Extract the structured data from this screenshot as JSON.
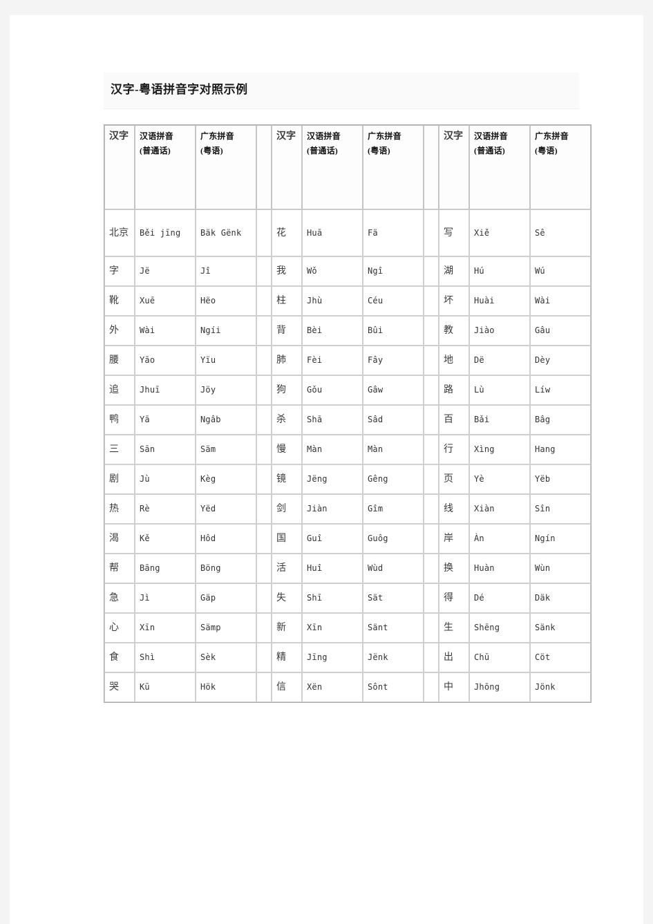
{
  "document": {
    "title": "汉字-粤语拼音字对照示例"
  },
  "table": {
    "headers": {
      "hanzi": "汉字",
      "mandarin": "汉语拼音（普通话）",
      "cantonese": "广东拼音（粤语）",
      "spacer": ""
    },
    "header_parts": {
      "hanzi": "汉字",
      "mandarin_line1": "汉语拼音",
      "mandarin_line2": "(普通话)",
      "cantonese_line1": "广东拼音",
      "cantonese_line2": "(粤语)"
    },
    "rows": [
      {
        "a": {
          "hanzi": "北京",
          "mandarin": "Běi jīng",
          "cantonese": "Bäk Gënk"
        },
        "b": {
          "hanzi": "花",
          "mandarin": "Huā",
          "cantonese": "Fä"
        },
        "c": {
          "hanzi": "写",
          "mandarin": "Xiě",
          "cantonese": "Sê"
        }
      },
      {
        "a": {
          "hanzi": "字",
          "mandarin": "Jë",
          "cantonese": "Jî"
        },
        "b": {
          "hanzi": "我",
          "mandarin": "Wǒ",
          "cantonese": "Ngî"
        },
        "c": {
          "hanzi": "湖",
          "mandarin": "Hú",
          "cantonese": "Wú"
        }
      },
      {
        "a": {
          "hanzi": "靴",
          "mandarin": "Xuē",
          "cantonese": "Hëo"
        },
        "b": {
          "hanzi": "柱",
          "mandarin": "Jhù",
          "cantonese": "Céu"
        },
        "c": {
          "hanzi": "坏",
          "mandarin": "Huài",
          "cantonese": "Wài"
        }
      },
      {
        "a": {
          "hanzi": "外",
          "mandarin": "Wài",
          "cantonese": "Ngíi"
        },
        "b": {
          "hanzi": "背",
          "mandarin": "Bèi",
          "cantonese": "Bûi"
        },
        "c": {
          "hanzi": "教",
          "mandarin": "Jiào",
          "cantonese": "Gâu"
        }
      },
      {
        "a": {
          "hanzi": "腰",
          "mandarin": "Yāo",
          "cantonese": "Yïu"
        },
        "b": {
          "hanzi": "肺",
          "mandarin": "Fèi",
          "cantonese": "Fây"
        },
        "c": {
          "hanzi": "地",
          "mandarin": "Dë",
          "cantonese": "Dèy"
        }
      },
      {
        "a": {
          "hanzi": "追",
          "mandarin": "Jhuī",
          "cantonese": "Jöy"
        },
        "b": {
          "hanzi": "狗",
          "mandarin": "Gǒu",
          "cantonese": "Gâw"
        },
        "c": {
          "hanzi": "路",
          "mandarin": "Lù",
          "cantonese": "Líw"
        }
      },
      {
        "a": {
          "hanzi": "鸭",
          "mandarin": "Yā",
          "cantonese": "Ngâb"
        },
        "b": {
          "hanzi": "杀",
          "mandarin": "Shā",
          "cantonese": "Sâd"
        },
        "c": {
          "hanzi": "百",
          "mandarin": "Bǎi",
          "cantonese": "Bâg"
        }
      },
      {
        "a": {
          "hanzi": "三",
          "mandarin": "Sān",
          "cantonese": "Säm"
        },
        "b": {
          "hanzi": "慢",
          "mandarin": "Màn",
          "cantonese": "Màn"
        },
        "c": {
          "hanzi": "行",
          "mandarin": "Xìng",
          "cantonese": "Hang"
        }
      },
      {
        "a": {
          "hanzi": "剧",
          "mandarin": "Jù",
          "cantonese": "Kèg"
        },
        "b": {
          "hanzi": "镜",
          "mandarin": "Jëng",
          "cantonese": "Gêng"
        },
        "c": {
          "hanzi": "页",
          "mandarin": "Yè",
          "cantonese": "Yëb"
        }
      },
      {
        "a": {
          "hanzi": "热",
          "mandarin": "Rè",
          "cantonese": "Yëd"
        },
        "b": {
          "hanzi": "剑",
          "mandarin": "Jiàn",
          "cantonese": "Gîm"
        },
        "c": {
          "hanzi": "线",
          "mandarin": "Xiàn",
          "cantonese": "Sîn"
        }
      },
      {
        "a": {
          "hanzi": "渴",
          "mandarin": "Kě",
          "cantonese": "Hôd"
        },
        "b": {
          "hanzi": "国",
          "mandarin": "Guî",
          "cantonese": "Guôg"
        },
        "c": {
          "hanzi": "岸",
          "mandarin": "Àn",
          "cantonese": "Ngín"
        }
      },
      {
        "a": {
          "hanzi": "帮",
          "mandarin": "Bāng",
          "cantonese": "Böng"
        },
        "b": {
          "hanzi": "活",
          "mandarin": "Huî",
          "cantonese": "Wùd"
        },
        "c": {
          "hanzi": "换",
          "mandarin": "Huàn",
          "cantonese": "Wùn"
        }
      },
      {
        "a": {
          "hanzi": "急",
          "mandarin": "Jì",
          "cantonese": "Gäp"
        },
        "b": {
          "hanzi": "失",
          "mandarin": "Shī",
          "cantonese": "Sät"
        },
        "c": {
          "hanzi": "得",
          "mandarin": "Dé",
          "cantonese": "Däk"
        }
      },
      {
        "a": {
          "hanzi": "心",
          "mandarin": "Xīn",
          "cantonese": "Sämp"
        },
        "b": {
          "hanzi": "新",
          "mandarin": "Xīn",
          "cantonese": "Sänt"
        },
        "c": {
          "hanzi": "生",
          "mandarin": "Shēng",
          "cantonese": "Sänk"
        }
      },
      {
        "a": {
          "hanzi": "食",
          "mandarin": "Shì",
          "cantonese": "Sèk"
        },
        "b": {
          "hanzi": "精",
          "mandarin": "Jīng",
          "cantonese": "Jënk"
        },
        "c": {
          "hanzi": "出",
          "mandarin": "Chū",
          "cantonese": "Cöt"
        }
      },
      {
        "a": {
          "hanzi": "哭",
          "mandarin": "Kū",
          "cantonese": "Hök"
        },
        "b": {
          "hanzi": "信",
          "mandarin": "Xën",
          "cantonese": "Sônt"
        },
        "c": {
          "hanzi": "中",
          "mandarin": "Jhōng",
          "cantonese": "Jönk"
        }
      }
    ]
  },
  "colors": {
    "page_background": "#f4f4f4",
    "sheet_background": "#ffffff",
    "title_band": "#fafafa",
    "table_outer_border": "#a8a8a8",
    "cell_border": "#cfcfcf",
    "text": "#333333"
  }
}
